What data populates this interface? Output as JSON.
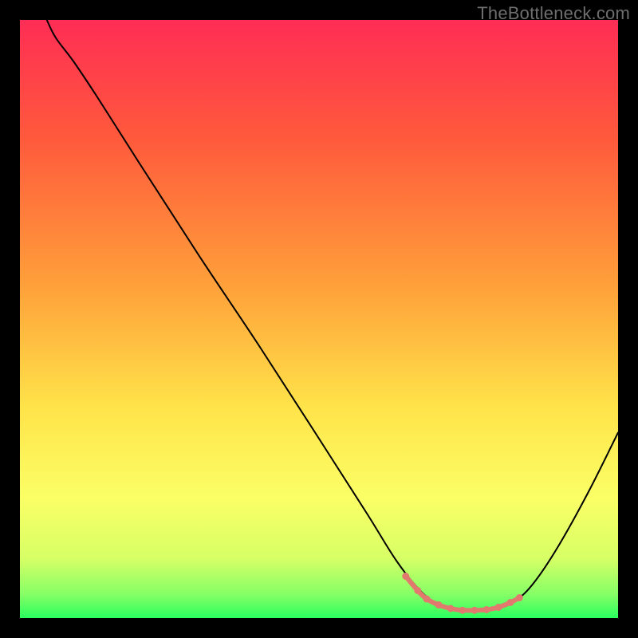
{
  "watermark": "TheBottleneck.com",
  "chart_data": {
    "type": "line",
    "title": "",
    "xlabel": "",
    "ylabel": "",
    "xlim": [
      0,
      100
    ],
    "ylim": [
      0,
      100
    ],
    "gradient_stops": [
      {
        "offset": 0,
        "color": "#ff2d55"
      },
      {
        "offset": 0.2,
        "color": "#ff5a3c"
      },
      {
        "offset": 0.45,
        "color": "#ffa23a"
      },
      {
        "offset": 0.65,
        "color": "#ffe44a"
      },
      {
        "offset": 0.8,
        "color": "#fbff66"
      },
      {
        "offset": 0.9,
        "color": "#d7ff66"
      },
      {
        "offset": 0.96,
        "color": "#86ff66"
      },
      {
        "offset": 1.0,
        "color": "#2aff5e"
      }
    ],
    "series": [
      {
        "name": "bottleneck-curve",
        "stroke": "#000000",
        "stroke_width": 2,
        "points": [
          {
            "x": 4.5,
            "y": 100.0
          },
          {
            "x": 6.0,
            "y": 97.0
          },
          {
            "x": 9.0,
            "y": 93.0
          },
          {
            "x": 13.0,
            "y": 87.0
          },
          {
            "x": 20.0,
            "y": 76.0
          },
          {
            "x": 30.0,
            "y": 60.5
          },
          {
            "x": 40.0,
            "y": 45.5
          },
          {
            "x": 50.0,
            "y": 30.0
          },
          {
            "x": 58.0,
            "y": 17.5
          },
          {
            "x": 63.0,
            "y": 9.5
          },
          {
            "x": 67.0,
            "y": 4.5
          },
          {
            "x": 70.0,
            "y": 2.2
          },
          {
            "x": 73.0,
            "y": 1.3
          },
          {
            "x": 77.0,
            "y": 1.3
          },
          {
            "x": 80.0,
            "y": 1.6
          },
          {
            "x": 83.0,
            "y": 3.0
          },
          {
            "x": 86.0,
            "y": 6.0
          },
          {
            "x": 90.0,
            "y": 12.0
          },
          {
            "x": 95.0,
            "y": 21.0
          },
          {
            "x": 100.0,
            "y": 31.0
          }
        ]
      },
      {
        "name": "trough-markers",
        "stroke": "#e2796f",
        "stroke_width": 6,
        "marker_radius": 4.5,
        "points": [
          {
            "x": 64.5,
            "y": 7.0
          },
          {
            "x": 66.5,
            "y": 4.6
          },
          {
            "x": 68.0,
            "y": 3.2
          },
          {
            "x": 70.0,
            "y": 2.2
          },
          {
            "x": 72.0,
            "y": 1.6
          },
          {
            "x": 74.0,
            "y": 1.3
          },
          {
            "x": 76.0,
            "y": 1.3
          },
          {
            "x": 78.0,
            "y": 1.4
          },
          {
            "x": 80.0,
            "y": 1.8
          },
          {
            "x": 82.0,
            "y": 2.6
          },
          {
            "x": 83.5,
            "y": 3.4
          }
        ]
      }
    ]
  }
}
